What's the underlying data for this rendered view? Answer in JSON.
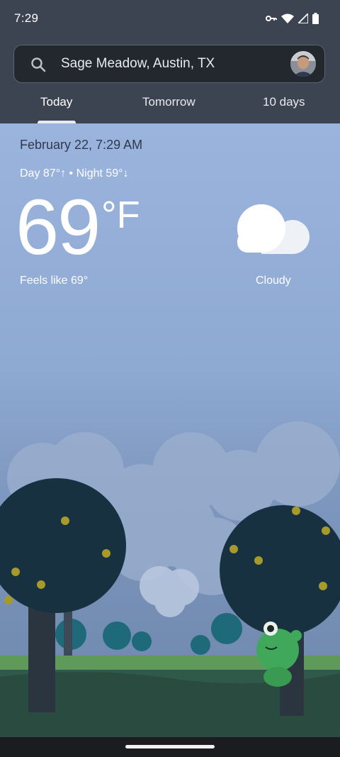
{
  "status_bar": {
    "time": "7:29",
    "icons": [
      "vpn-key-icon",
      "wifi-icon",
      "signal-icon",
      "battery-icon"
    ]
  },
  "search": {
    "location": "Sage Meadow, Austin, TX",
    "icon": "search-icon"
  },
  "tabs": [
    {
      "label": "Today",
      "active": true
    },
    {
      "label": "Tomorrow",
      "active": false
    },
    {
      "label": "10 days",
      "active": false
    }
  ],
  "weather": {
    "datetime": "February 22, 7:29 AM",
    "day_night": "Day 87°↑ • Night 59°↓",
    "temperature": "69",
    "unit": "°F",
    "feels_like": "Feels like 69°",
    "condition": "Cloudy",
    "condition_icon": "cloud-icon"
  },
  "colors": {
    "header": "#3c4452",
    "sky_top": "#9bb4dd",
    "sky_bottom": "#6d85aa"
  }
}
